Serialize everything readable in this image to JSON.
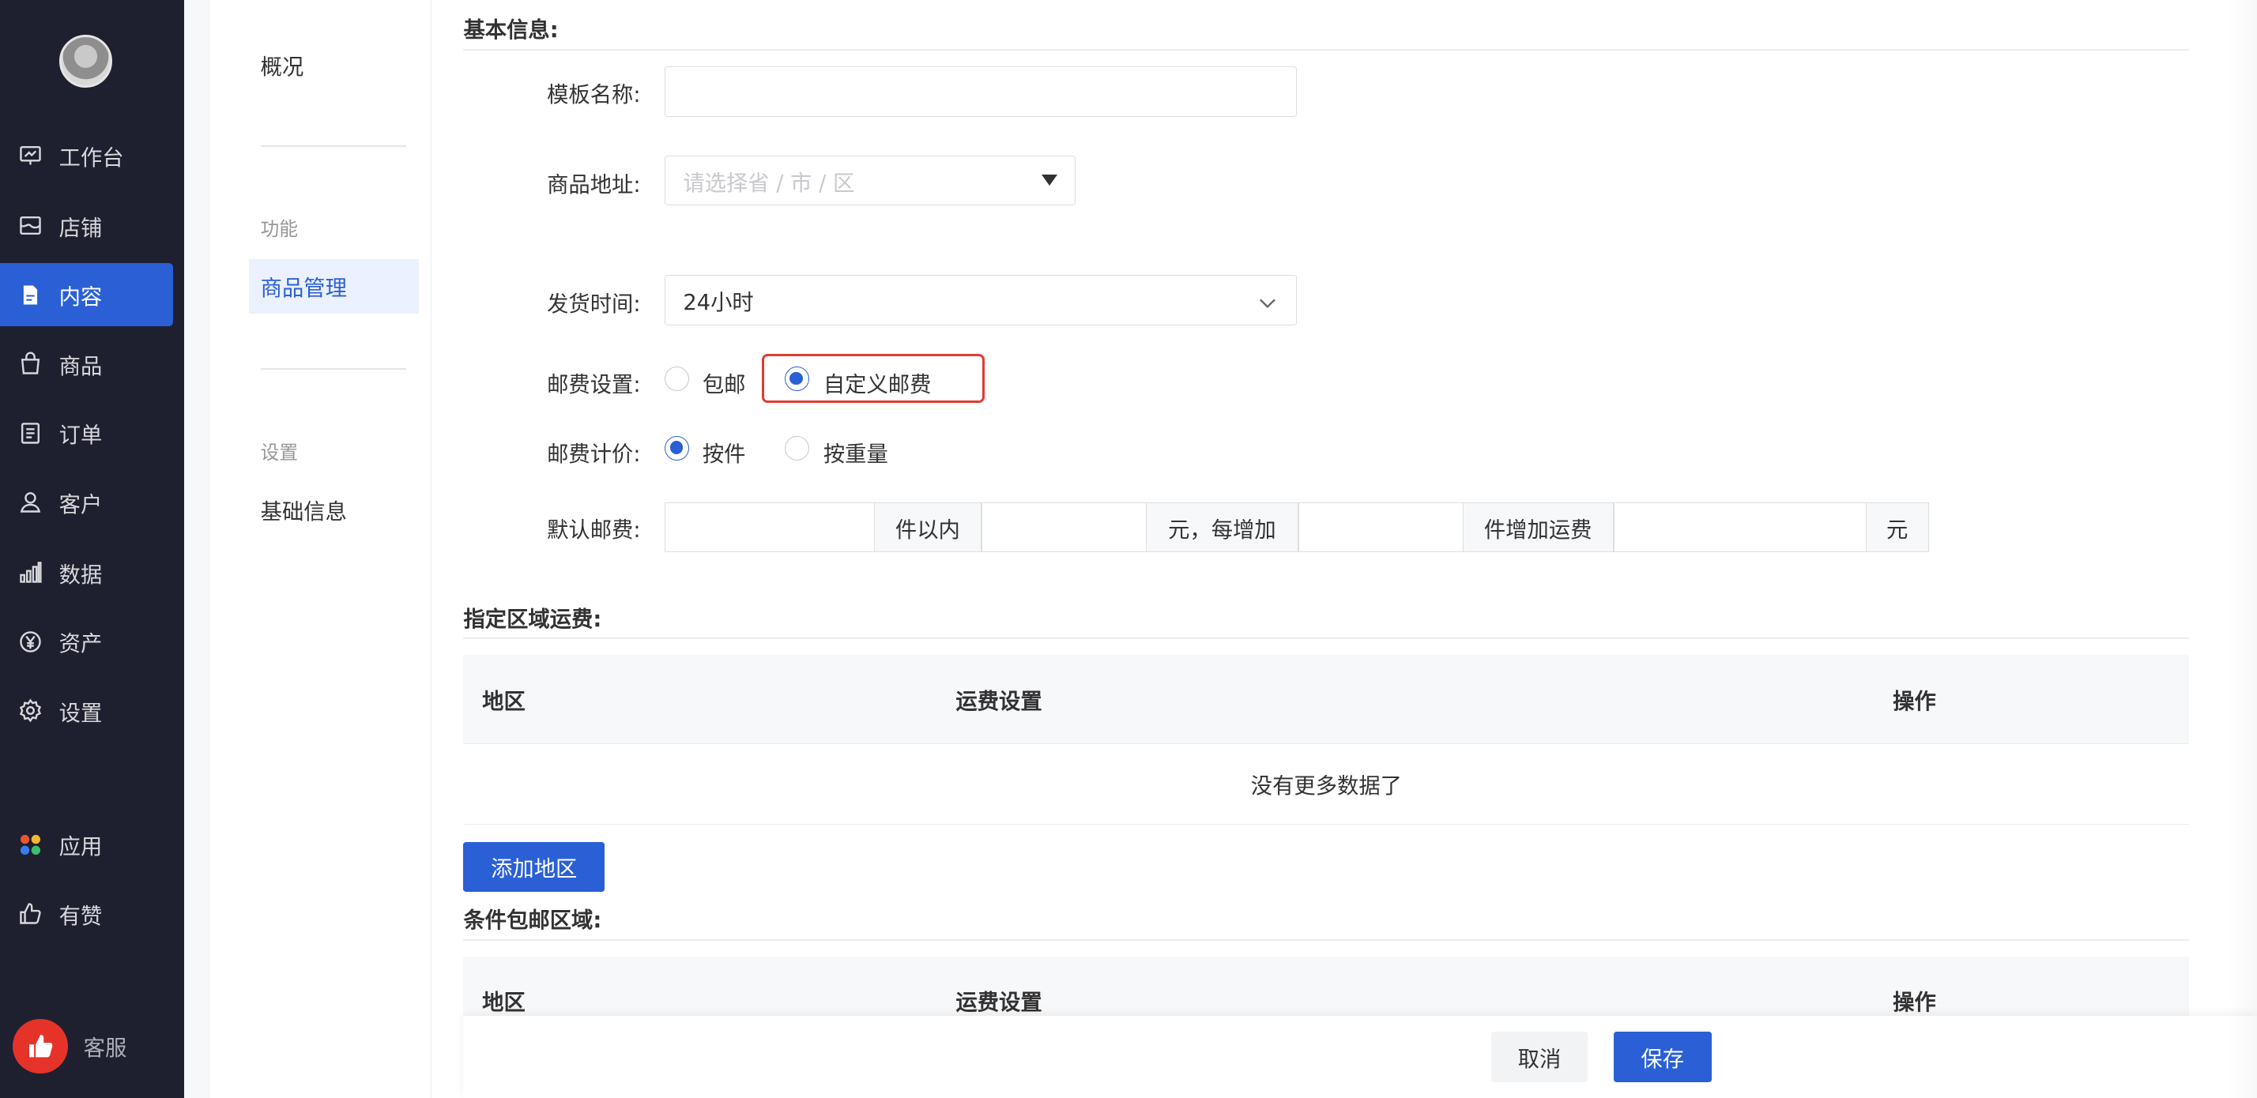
{
  "nav": {
    "items": [
      {
        "label": "工作台",
        "icon": "dashboard-icon"
      },
      {
        "label": "店铺",
        "icon": "shop-icon"
      },
      {
        "label": "内容",
        "icon": "document-icon",
        "active": true
      },
      {
        "label": "商品",
        "icon": "bag-icon"
      },
      {
        "label": "订单",
        "icon": "order-icon"
      },
      {
        "label": "客户",
        "icon": "user-icon"
      },
      {
        "label": "数据",
        "icon": "chart-icon"
      },
      {
        "label": "资产",
        "icon": "yuan-icon"
      },
      {
        "label": "设置",
        "icon": "gear-icon"
      },
      {
        "label": "应用",
        "icon": "apps-icon"
      },
      {
        "label": "有赞",
        "icon": "thumb-icon"
      }
    ],
    "service_label": "客服"
  },
  "subnav": {
    "overview": "概况",
    "group_function": "功能",
    "goods_manage": "商品管理",
    "group_settings": "设置",
    "basic_info": "基础信息"
  },
  "form": {
    "section_basic": "基本信息:",
    "template_name_label": "模板名称:",
    "template_name_value": "",
    "address_label": "商品地址:",
    "address_placeholder": "请选择省 / 市 / 区",
    "ship_time_label": "发货时间:",
    "ship_time_value": "24小时",
    "postage_label": "邮费设置:",
    "postage_options": [
      "包邮",
      "自定义邮费"
    ],
    "postage_selected": "自定义邮费",
    "pricing_label": "邮费计价:",
    "pricing_options": [
      "按件",
      "按重量"
    ],
    "pricing_selected": "按件",
    "default_fee_label": "默认邮费:",
    "addon_1": "件以内",
    "addon_2": "元，每增加",
    "addon_3": "件增加运费",
    "addon_4": "元"
  },
  "region": {
    "title": "指定区域运费:",
    "col_region": "地区",
    "col_setting": "运费设置",
    "col_action": "操作",
    "empty": "没有更多数据了",
    "add_button": "添加地区"
  },
  "conditional": {
    "title": "条件包邮区域:",
    "col_region": "地区",
    "col_setting": "运费设置",
    "col_action": "操作"
  },
  "footer": {
    "cancel": "取消",
    "save": "保存"
  },
  "colors": {
    "primary": "#2a5fd6",
    "nav_bg": "#1e1f2f",
    "highlight": "#e03c31"
  }
}
